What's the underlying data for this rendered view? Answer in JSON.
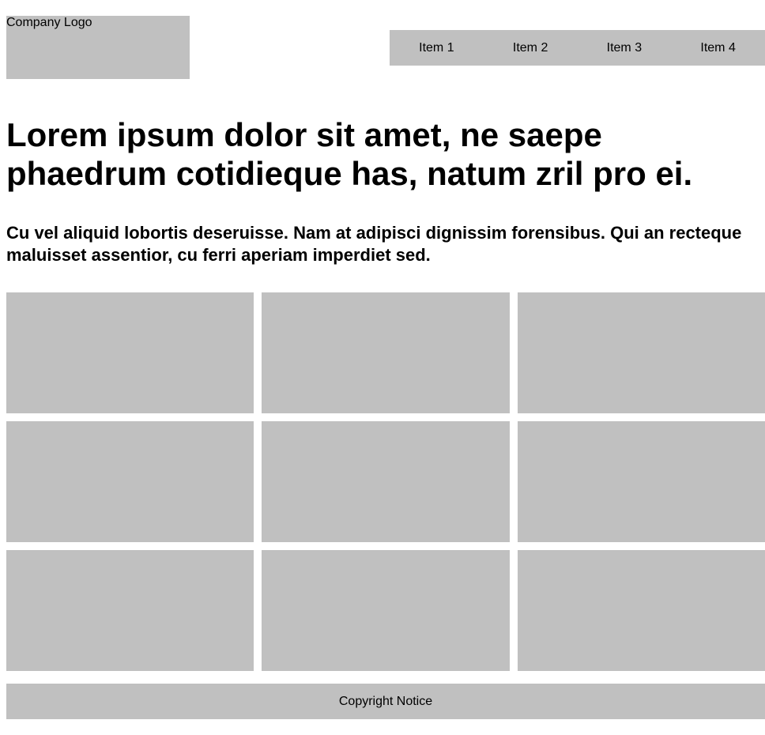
{
  "header": {
    "logo_text": "Company Logo",
    "nav_items": [
      {
        "label": "Item 1"
      },
      {
        "label": "Item 2"
      },
      {
        "label": "Item 3"
      },
      {
        "label": "Item 4"
      }
    ]
  },
  "main": {
    "headline": "Lorem ipsum dolor sit amet, ne saepe phaedrum cotidieque has, natum zril pro ei.",
    "subheadline": "Cu vel aliquid lobortis deseruisse. Nam at adipisci dignissim forensibus. Qui an recteque maluisset assentior, cu ferri aperiam imperdiet sed."
  },
  "footer": {
    "copyright": "Copyright Notice"
  },
  "colors": {
    "placeholder_gray": "#c0c0c0",
    "background": "#ffffff",
    "text": "#000000"
  }
}
